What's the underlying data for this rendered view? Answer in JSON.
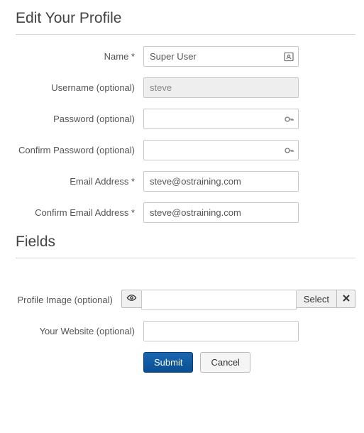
{
  "sections": {
    "edit_profile": "Edit Your Profile",
    "fields": "Fields"
  },
  "labels": {
    "name": "Name *",
    "username": "Username (optional)",
    "password": "Password (optional)",
    "confirm_password": "Confirm Password (optional)",
    "email": "Email Address *",
    "confirm_email": "Confirm Email Address *",
    "profile_image": "Profile Image (optional)",
    "website": "Your Website (optional)"
  },
  "values": {
    "name": "Super User",
    "username": "steve",
    "password": "",
    "confirm_password": "",
    "email": "steve@ostraining.com",
    "confirm_email": "steve@ostraining.com",
    "profile_image": "",
    "website": ""
  },
  "buttons": {
    "select": "Select",
    "submit": "Submit",
    "cancel": "Cancel"
  }
}
